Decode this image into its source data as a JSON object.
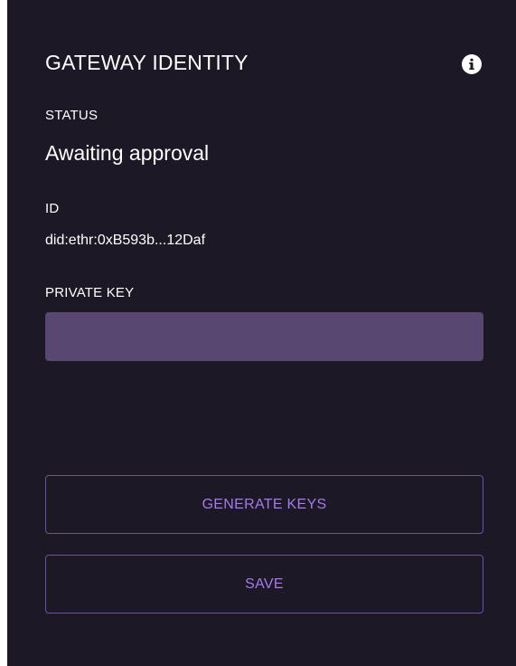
{
  "panel": {
    "title": "GATEWAY IDENTITY",
    "info_icon": "info-icon"
  },
  "status": {
    "label": "STATUS",
    "value": "Awaiting approval"
  },
  "identity": {
    "label": "ID",
    "value": "did:ethr:0xB593b...12Daf"
  },
  "private_key": {
    "label": "PRIVATE KEY",
    "value": "",
    "placeholder": ""
  },
  "actions": {
    "generate_label": "GENERATE KEYS",
    "save_label": "SAVE"
  },
  "colors": {
    "panel_background": "#1c1826",
    "input_background": "#574771",
    "accent": "#a679ee",
    "button_border": "#6c4fae"
  }
}
